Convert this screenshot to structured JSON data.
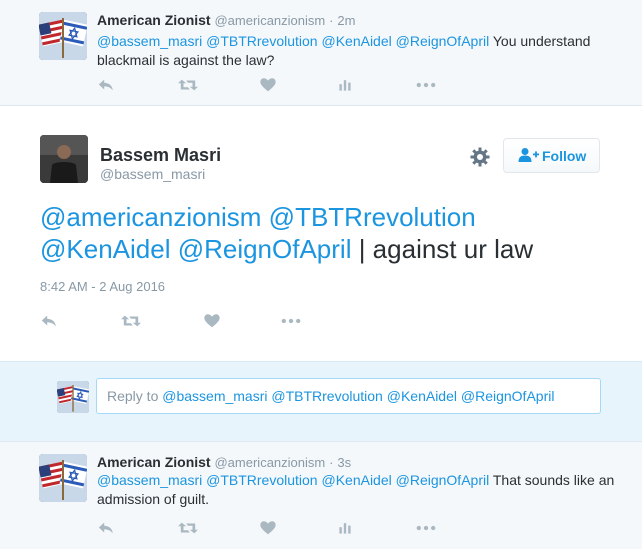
{
  "tweet_top": {
    "author_name": "American Zionist",
    "author_handle": "@americanzionism",
    "separator": "·",
    "time": "2m",
    "mentions": "@bassem_masri @TBTRrevolution @KenAidel @ReignOfApril",
    "text": " You understand blackmail is against the law?"
  },
  "main_tweet": {
    "author_name": "Bassem Masri",
    "author_handle": "@bassem_masri",
    "follow_label": "Follow",
    "mentions_line1": "@americanzionism @TBTRrevolution",
    "mentions_line2": "@KenAidel @ReignOfApril",
    "text": " | against ur law",
    "date": "8:42 AM - 2 Aug 2016"
  },
  "reply": {
    "prefix": "Reply to ",
    "mentions": "@bassem_masri @TBTRrevolution @KenAidel @ReignOfApril"
  },
  "tweet_bottom": {
    "author_name": "American Zionist",
    "author_handle": "@americanzionism",
    "separator": "·",
    "time": "3s",
    "mentions": "@bassem_masri @TBTRrevolution @KenAidel @ReignOfApril",
    "text": " That sounds like an admission of guilt."
  },
  "icons": {
    "reply": "reply-icon",
    "retweet": "retweet-icon",
    "like": "heart-icon",
    "analytics": "analytics-icon",
    "more": "more-icon",
    "settings": "gear-icon",
    "follow": "follow-user-icon"
  },
  "colors": {
    "link": "#1b95e0",
    "text": "#292f33",
    "muted": "#8899a6",
    "icon": "#aab8c2",
    "reply_bar_bg": "#e8f4fb",
    "tweet_bg": "#f5f8fa"
  }
}
